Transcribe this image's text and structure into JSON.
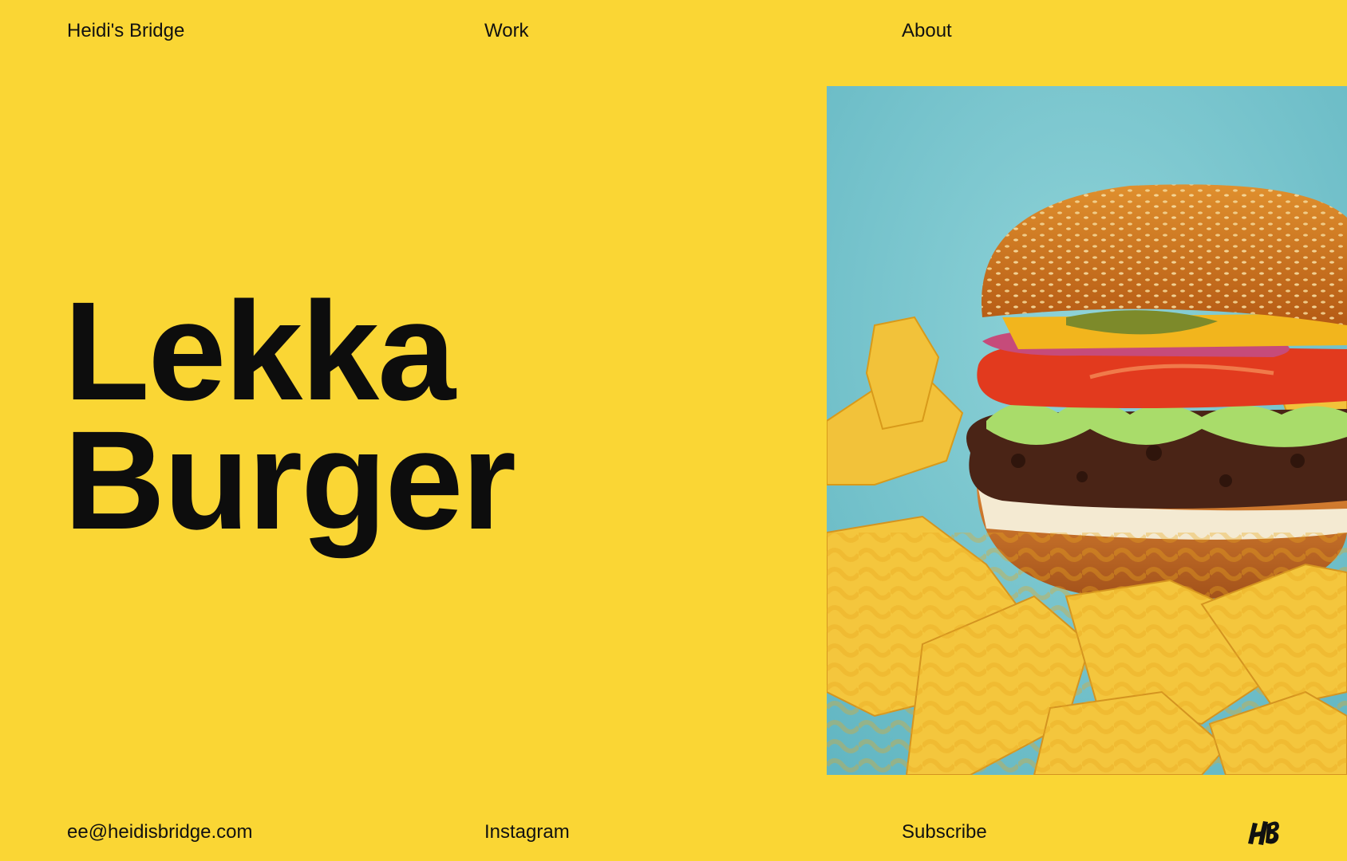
{
  "header": {
    "brand": "Heidi's Bridge",
    "nav": {
      "work": "Work",
      "about": "About"
    }
  },
  "hero": {
    "title_line1": "Lekka",
    "title_line2": "Burger",
    "image_subject": "Lekka burger with crinkle-cut fries on a turquoise background"
  },
  "footer": {
    "email": "ee@heidisbridge.com",
    "instagram": "Instagram",
    "subscribe": "Subscribe",
    "logo_icon": "hb-monogram-icon"
  },
  "colors": {
    "background": "#fad634",
    "text": "#111111",
    "photo_backdrop": "#7cc8cf"
  }
}
